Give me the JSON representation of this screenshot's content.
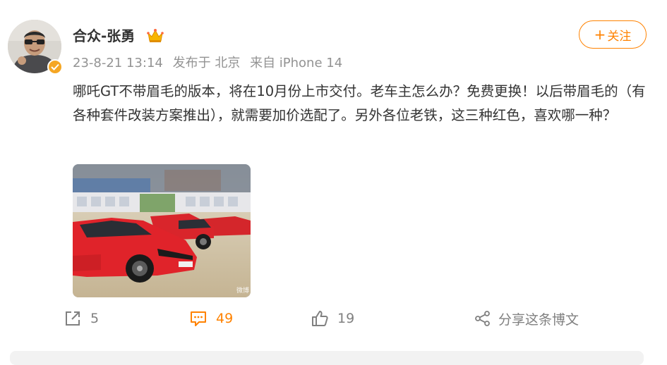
{
  "post": {
    "username": "合众-张勇",
    "timestamp": "23-8-21 13:14",
    "location": "发布于 北京",
    "source": "来自 iPhone 14",
    "follow_label": "关注",
    "text": "哪吒GT不带眉毛的版本，将在10月份上市交付。老车主怎么办？免费更换！以后带眉毛的（有各种套件改装方案推出），就需要加价选配了。另外各位老铁，这三种红色，喜欢哪一种？",
    "watermark": "微博"
  },
  "actions": {
    "repost_count": "5",
    "comment_count": "49",
    "like_count": "19",
    "share_label": "分享这条博文"
  },
  "colors": {
    "accent": "#ff8200",
    "meta_text": "#939393",
    "icon_gray": "#808080"
  },
  "icons": [
    "verified-badge-icon",
    "crown-icon",
    "plus-icon",
    "repost-icon",
    "comment-icon",
    "like-icon",
    "share-icon"
  ]
}
